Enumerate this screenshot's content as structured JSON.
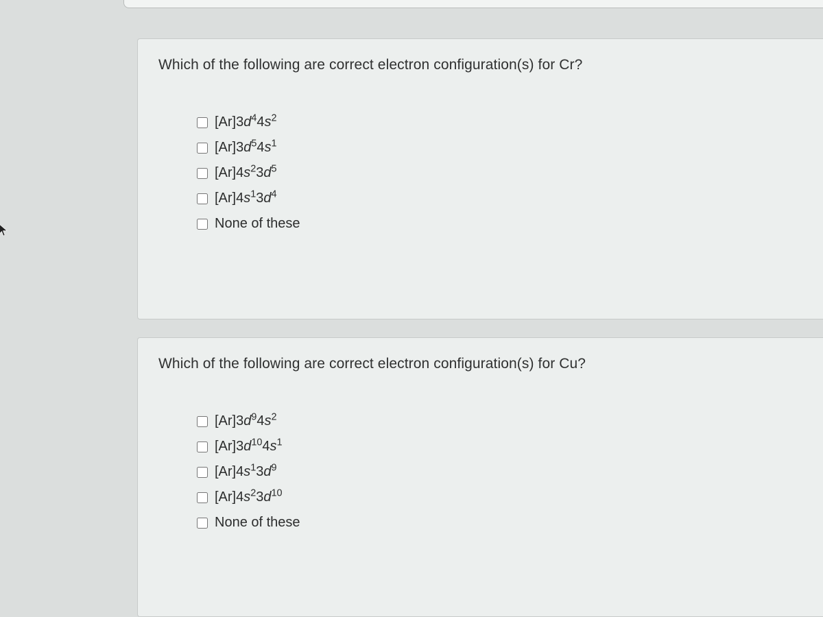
{
  "questions": [
    {
      "prompt": "Which of the following are correct electron configuration(s) for Cr?",
      "options": [
        {
          "prefix": "[Ar]3",
          "orb1": "d",
          "sup1": "4",
          "mid": "4",
          "orb2": "s",
          "sup2": "2",
          "plain": null
        },
        {
          "prefix": "[Ar]3",
          "orb1": "d",
          "sup1": "5",
          "mid": "4",
          "orb2": "s",
          "sup2": "1",
          "plain": null
        },
        {
          "prefix": "[Ar]4",
          "orb1": "s",
          "sup1": "2",
          "mid": "3",
          "orb2": "d",
          "sup2": "5",
          "plain": null
        },
        {
          "prefix": "[Ar]4",
          "orb1": "s",
          "sup1": "1",
          "mid": "3",
          "orb2": "d",
          "sup2": "4",
          "plain": null
        },
        {
          "plain": "None of these"
        }
      ]
    },
    {
      "prompt": "Which of the following are correct electron configuration(s) for Cu?",
      "options": [
        {
          "prefix": "[Ar]3",
          "orb1": "d",
          "sup1": "9",
          "mid": "4",
          "orb2": "s",
          "sup2": "2",
          "plain": null
        },
        {
          "prefix": "[Ar]3",
          "orb1": "d",
          "sup1": "10",
          "mid": "4",
          "orb2": "s",
          "sup2": "1",
          "plain": null
        },
        {
          "prefix": "[Ar]4",
          "orb1": "s",
          "sup1": "1",
          "mid": "3",
          "orb2": "d",
          "sup2": "9",
          "plain": null
        },
        {
          "prefix": "[Ar]4",
          "orb1": "s",
          "sup1": "2",
          "mid": "3",
          "orb2": "d",
          "sup2": "10",
          "plain": null
        },
        {
          "plain": "None of these"
        }
      ]
    }
  ]
}
